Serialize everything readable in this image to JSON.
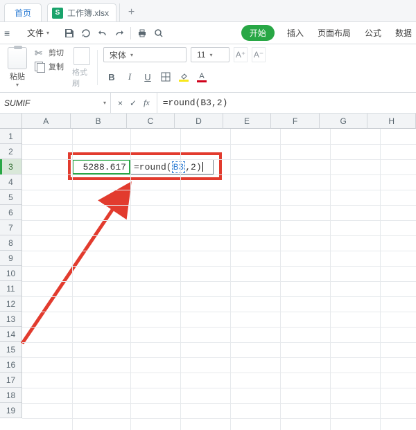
{
  "tabs": {
    "home": "首页",
    "file": "工作簿.xlsx",
    "file_icon_letter": "S"
  },
  "menubar": {
    "file_menu": "文件",
    "start": "开始",
    "items": [
      "插入",
      "页面布局",
      "公式",
      "数据"
    ]
  },
  "ribbon": {
    "paste": "粘贴",
    "cut": "剪切",
    "copy": "复制",
    "format_painter": "格式刷",
    "font_name": "宋体",
    "font_size": "11",
    "bold": "B",
    "italic": "I",
    "underline": "U",
    "font_color": "#d0021b",
    "fill_color": "#f8e71c"
  },
  "fx": {
    "name_box": "SUMIF",
    "cancel": "×",
    "accept": "✓",
    "fx_label": "fx",
    "formula": "=round(B3,2)"
  },
  "grid": {
    "columns": [
      "A",
      "B",
      "C",
      "D",
      "E",
      "F",
      "G",
      "H"
    ],
    "rows": 19,
    "active_row": 3,
    "b3_value": "5288.617",
    "c3_prefix": "=round(",
    "c3_ref": "B3",
    "c3_suffix": ",2)"
  }
}
